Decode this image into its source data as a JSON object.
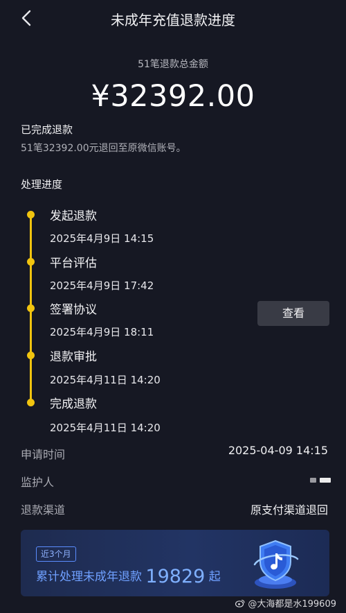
{
  "header": {
    "title": "未成年充值退款进度"
  },
  "summary": {
    "label": "51笔退款总金额",
    "amount": "¥32392.00"
  },
  "completed": {
    "title": "已完成退款",
    "desc": "51笔32392.00元退回至原微信账号。"
  },
  "progress": {
    "title": "处理进度",
    "steps": [
      {
        "name": "发起退款",
        "time": "2025年4月9日  14:15"
      },
      {
        "name": "平台评估",
        "time": "2025年4月9日  17:42"
      },
      {
        "name": "签署协议",
        "time": "2025年4月9日  18:11"
      },
      {
        "name": "退款审批",
        "time": "2025年4月11日  14:20"
      },
      {
        "name": "完成退款",
        "time": "2025年4月11日  14:20"
      }
    ],
    "view_button": "查看",
    "accent_color": "#f1c40f"
  },
  "details": {
    "apply_time_label": "申请时间",
    "apply_time_value": "2025-04-09 14:15",
    "guardian_label": "监护人",
    "channel_label": "退款渠道",
    "channel_value": "原支付渠道退回"
  },
  "banner": {
    "badge": "近3个月",
    "text_prefix": "累计处理未成年退款",
    "count": "19829",
    "text_suffix": "起"
  },
  "watermark": "@大海都是水199609"
}
